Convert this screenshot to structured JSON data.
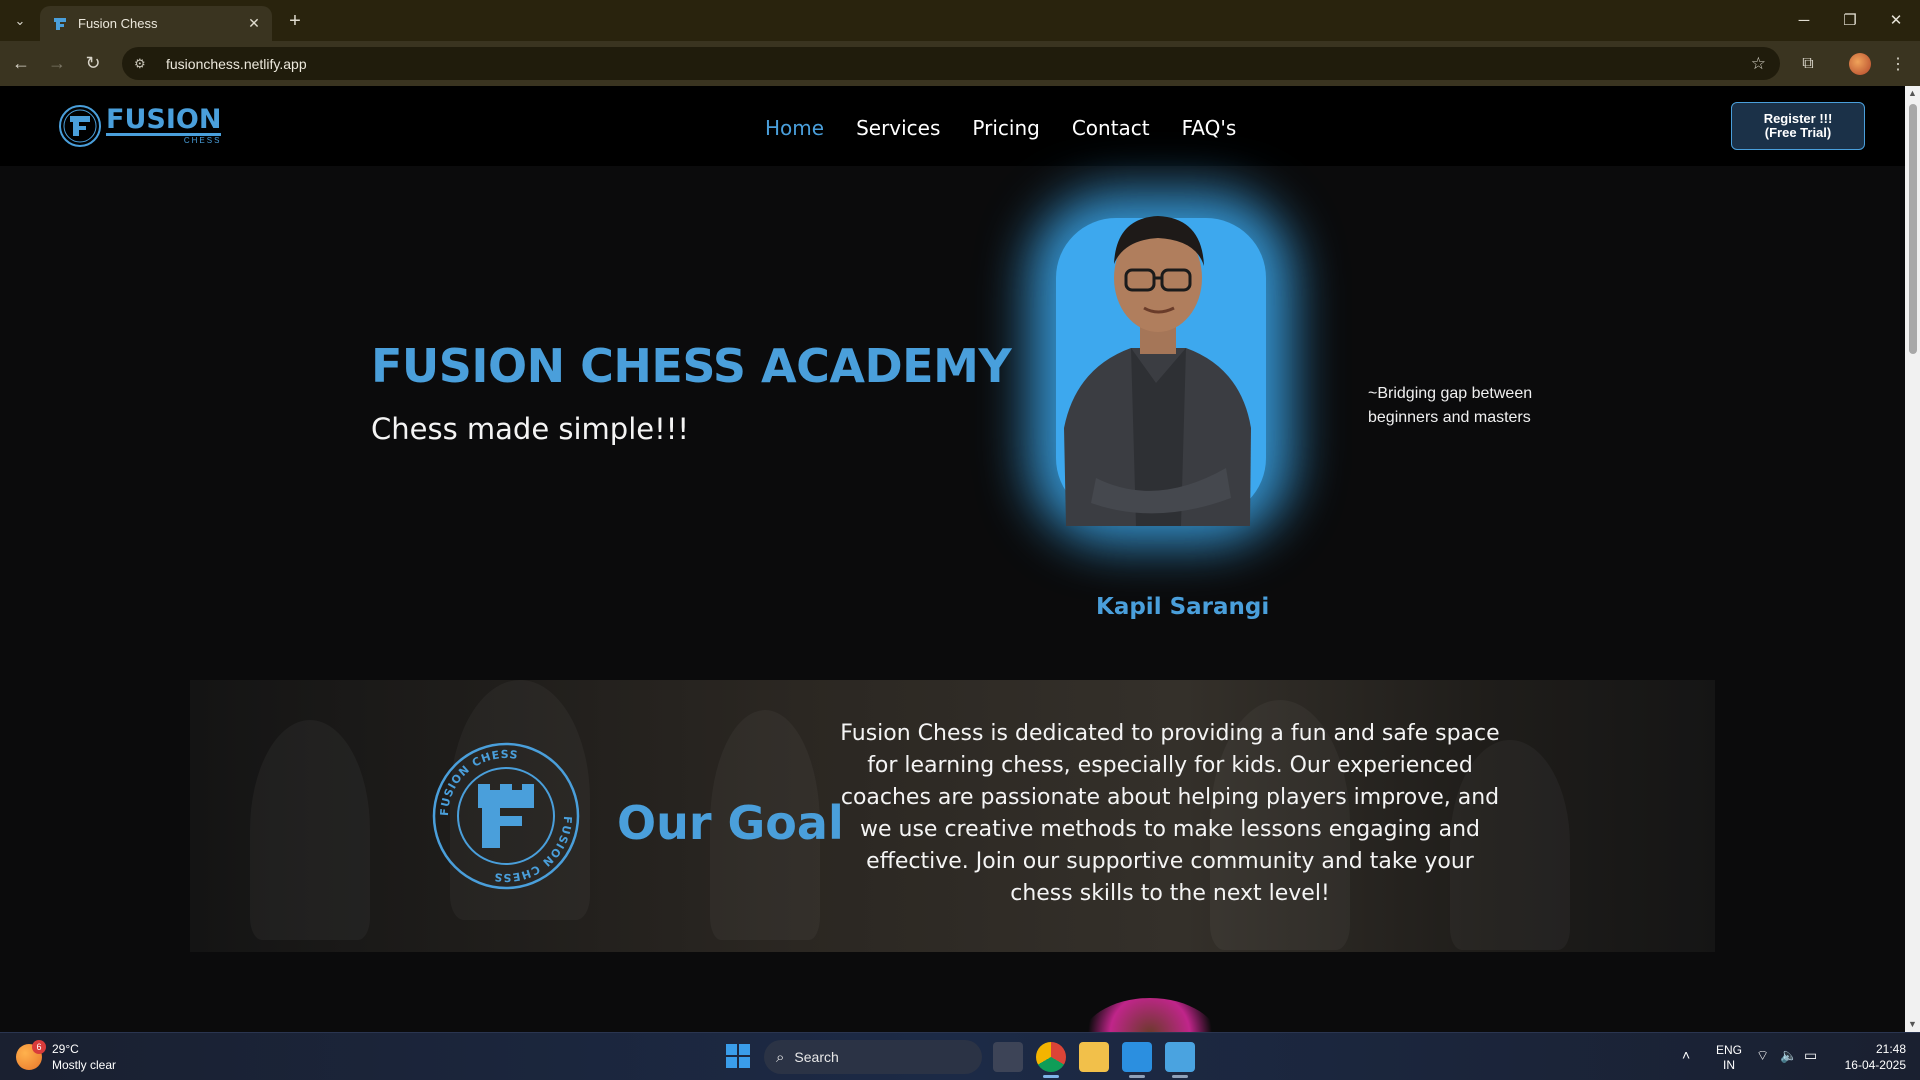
{
  "browser": {
    "tab_title": "Fusion Chess",
    "url": "fusionchess.netlify.app",
    "tab_list_icon": "chevron-down-icon",
    "new_tab_icon": "plus-icon"
  },
  "site": {
    "nav": [
      {
        "label": "Home",
        "active": true
      },
      {
        "label": "Services",
        "active": false
      },
      {
        "label": "Pricing",
        "active": false
      },
      {
        "label": "Contact",
        "active": false
      },
      {
        "label": "FAQ's",
        "active": false
      }
    ],
    "register_line1": "Register !!!",
    "register_line2": "(Free Trial)",
    "logo_word": "FUSION",
    "logo_sub": "CHESS",
    "accent_color": "#4a9fdb"
  },
  "hero": {
    "title": "FUSION CHESS ACADEMY",
    "subtitle": "Chess made simple!!!",
    "coach_name": "Kapil Sarangi",
    "quote": "~Bridging gap between beginners and masters"
  },
  "goal": {
    "title": "Our Goal",
    "emblem_text": "FUSION CHESS",
    "text": "Fusion Chess is dedicated to providing a fun and safe space for learning chess, especially for kids. Our experienced coaches are passionate about helping players improve, and we use creative methods to make lessons engaging and effective. Join our supportive community and take your chess skills to the next level!"
  },
  "taskbar": {
    "temperature": "29°C",
    "weather": "Mostly clear",
    "weather_badge": "6",
    "search_label": "Search",
    "lang_line1": "ENG",
    "lang_line2": "IN",
    "time": "21:48",
    "date": "16-04-2025"
  }
}
